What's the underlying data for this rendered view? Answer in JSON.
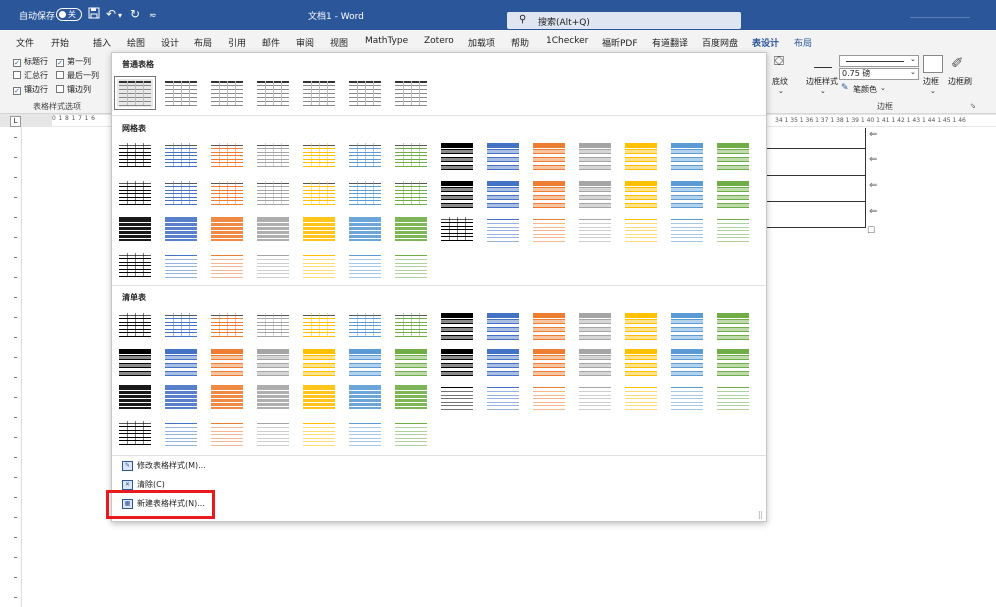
{
  "titlebar": {
    "autosave": "自动保存",
    "toggle": "关",
    "save_icon": "save-icon",
    "undo_icon": "undo-icon",
    "redo_icon": "redo-icon",
    "document_title": "文档1  -  Word",
    "search_placeholder": "搜索(Alt+Q)"
  },
  "tabs": [
    "文件",
    "开始",
    "插入",
    "绘图",
    "设计",
    "布局",
    "引用",
    "邮件",
    "审阅",
    "视图",
    "MathType",
    "Zotero",
    "加载项",
    "帮助",
    "1Checker",
    "福昕PDF",
    "有道翻译",
    "百度网盘",
    "表设计",
    "布局"
  ],
  "active_tab": "表设计",
  "style_options": {
    "items": [
      {
        "label": "标题行",
        "checked": true
      },
      {
        "label": "第一列",
        "checked": true
      },
      {
        "label": "汇总行",
        "checked": false
      },
      {
        "label": "最后一列",
        "checked": false
      },
      {
        "label": "镶边行",
        "checked": true
      },
      {
        "label": "镶边列",
        "checked": false
      }
    ],
    "group_label": "表格样式选项"
  },
  "borders_group": {
    "shading": "底纹",
    "border_styles": "边框样式",
    "weight": "0.75 磅",
    "pen_color": "笔颜色",
    "borders": "边框",
    "border_painter": "边框刷",
    "group_label": "边框"
  },
  "ruler": {
    "left_marks": "0  1  8  1  7  1  6",
    "right_marks": "34  1  35  1  36  1  37  1  38  1  39  1  40  1  41  1  42  1  43  1  44  1  45  1  46",
    "tab_glyph": "L"
  },
  "gallery": {
    "plain_header": "普通表格",
    "grid_header": "网格表",
    "list_header": "清单表",
    "colors": [
      "#000000",
      "#4472c4",
      "#ed7d31",
      "#a5a5a5",
      "#ffc000",
      "#5b9bd5",
      "#70ad47"
    ],
    "menu": {
      "modify": "修改表格样式(M)...",
      "clear": "清除(C)",
      "new": "新建表格样式(N)..."
    }
  }
}
